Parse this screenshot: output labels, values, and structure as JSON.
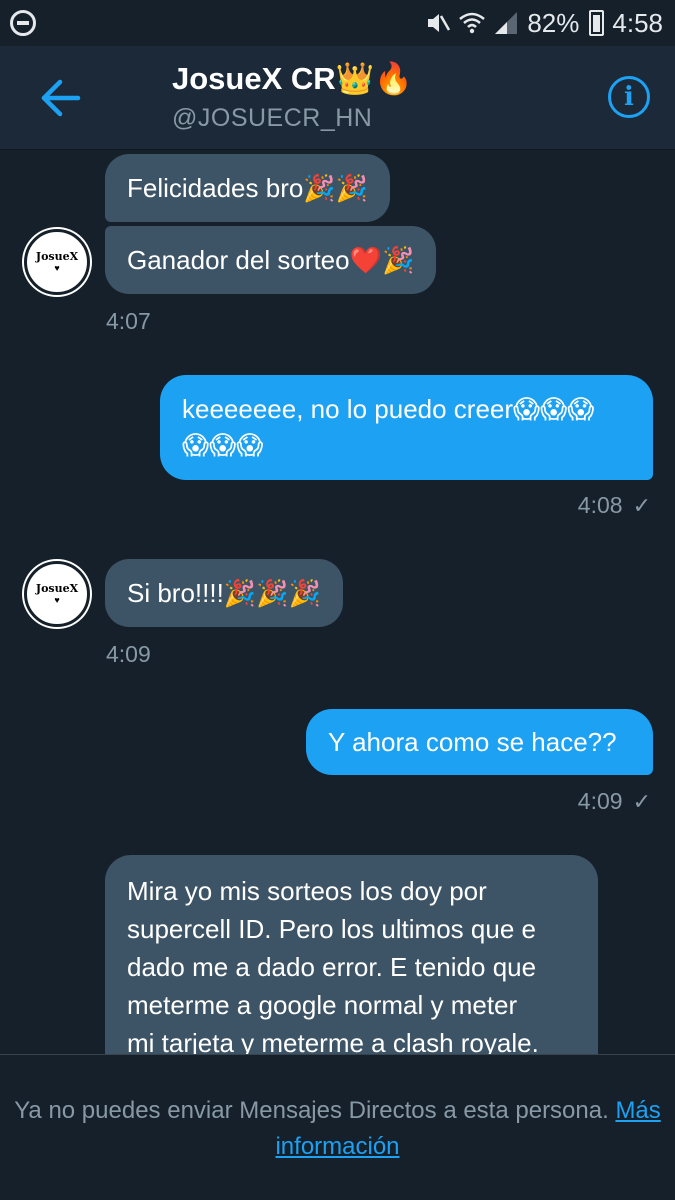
{
  "status_bar": {
    "battery": "82%",
    "time": "4:58",
    "icons": [
      "dnd-icon",
      "mute-icon",
      "wifi-icon",
      "signal-icon",
      "battery-icon"
    ]
  },
  "header": {
    "name": "JosueX CR👑🔥",
    "handle": "@JOSUECR_HN",
    "accent": "#1da1f2"
  },
  "avatar": {
    "text": "JosueX",
    "heart": "♥"
  },
  "messages": [
    {
      "from": "them",
      "text": "Felicidades bro🎉🎉"
    },
    {
      "from": "them",
      "text": "Ganador del sorteo❤️🎉"
    },
    {
      "from": "them",
      "time": "4:07"
    },
    {
      "from": "me",
      "line1": "keeeeeee, no lo puedo creer😱😱😱",
      "line2": "😱😱😱",
      "time": "4:08"
    },
    {
      "from": "them",
      "text": "Si bro!!!!🎉🎉🎉",
      "time": "4:09"
    },
    {
      "from": "me",
      "text": "Y ahora como se hace??",
      "time": "4:09"
    },
    {
      "from": "them",
      "lines": [
        "Mira yo mis sorteos los doy por",
        "supercell ID. Pero los ultimos que e",
        "dado me a dado error. E tenido que",
        "meterme a google normal y meter",
        "mi tarjeta y meterme a clash royale."
      ]
    }
  ],
  "footer": {
    "text_before": "Ya no puedes enviar Mensajes Directos a esta persona.",
    "link": "Más información"
  },
  "colors": {
    "background": "#15202b",
    "header": "#1c2938",
    "incoming_bubble": "#3d5466",
    "outgoing_bubble": "#1da1f2",
    "muted_text": "#8899a6"
  }
}
